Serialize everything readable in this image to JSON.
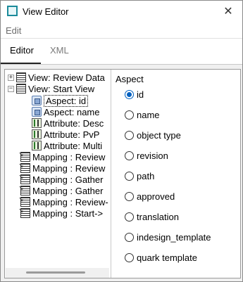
{
  "window": {
    "title": "View Editor",
    "close_symbol": "✕"
  },
  "menu": {
    "edit": "Edit"
  },
  "tabs": [
    {
      "label": "Editor",
      "active": true
    },
    {
      "label": "XML",
      "active": false
    }
  ],
  "tree": {
    "items": [
      {
        "label": "View: Review Data",
        "icon": "view-icon",
        "expander": "+"
      },
      {
        "label": "View: Start View",
        "icon": "view-icon",
        "expander": "−"
      },
      {
        "label": "Aspect: id",
        "icon": "aspect-icon",
        "selected": true
      },
      {
        "label": "Aspect: name",
        "icon": "aspect-icon"
      },
      {
        "label": "Attribute: Desc",
        "icon": "attribute-icon"
      },
      {
        "label": "Attribute: PvP",
        "icon": "attribute-icon"
      },
      {
        "label": "Attribute: Multi",
        "icon": "attribute-icon"
      },
      {
        "label": "Mapping : Review",
        "icon": "mapping-icon"
      },
      {
        "label": "Mapping : Review",
        "icon": "mapping-icon"
      },
      {
        "label": "Mapping : Gather",
        "icon": "mapping-icon"
      },
      {
        "label": "Mapping : Gather",
        "icon": "mapping-icon"
      },
      {
        "label": "Mapping : Review-",
        "icon": "mapping-icon"
      },
      {
        "label": "Mapping : Start->",
        "icon": "mapping-icon"
      }
    ]
  },
  "aspect_panel": {
    "title": "Aspect",
    "options": [
      {
        "label": "id",
        "checked": true
      },
      {
        "label": "name",
        "checked": false
      },
      {
        "label": "object type",
        "checked": false
      },
      {
        "label": "revision",
        "checked": false
      },
      {
        "label": "path",
        "checked": false
      },
      {
        "label": "approved",
        "checked": false
      },
      {
        "label": "translation",
        "checked": false
      },
      {
        "label": "indesign_template",
        "checked": false
      },
      {
        "label": "quark template",
        "checked": false
      }
    ]
  },
  "colors": {
    "accent": "#0060c0",
    "app_icon": "#1a8a9a"
  }
}
